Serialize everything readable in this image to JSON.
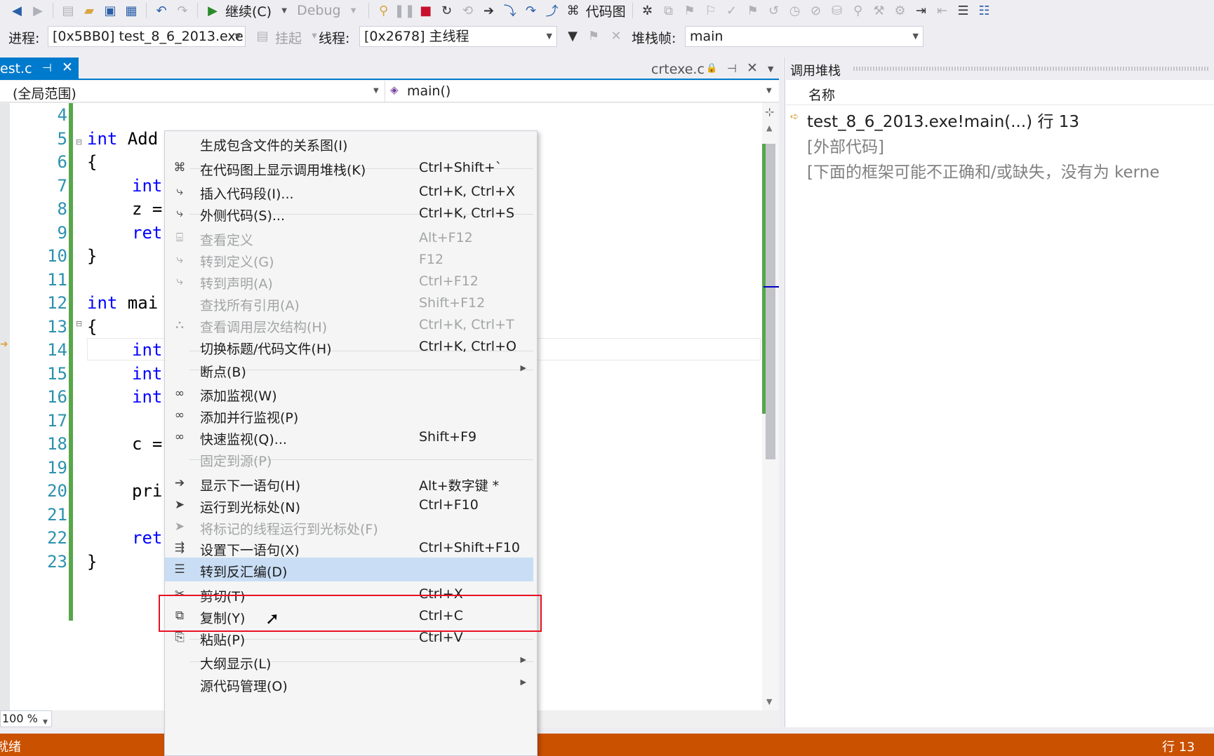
{
  "toolbar": {
    "continue_label": "继续(C)",
    "config_label": "Debug",
    "codemap_label": "代码图"
  },
  "debugbar": {
    "process_label": "进程:",
    "process_value": "[0x5BB0] test_8_6_2013.exe",
    "suspend_label": "挂起",
    "thread_label": "线程:",
    "thread_value": "[0x2678] 主线程",
    "stackframe_label": "堆栈帧:",
    "stackframe_value": "main"
  },
  "tabs": {
    "active": "est.c",
    "second": "crtexe.c"
  },
  "navbar": {
    "scope": "(全局范围)",
    "function": "main()"
  },
  "editor": {
    "lines": [
      {
        "num": "4",
        "kw": "",
        "rest": ""
      },
      {
        "num": "5",
        "kw": "int",
        "rest": " Add"
      },
      {
        "num": "6",
        "kw": "",
        "rest": "{"
      },
      {
        "num": "7",
        "kw": "int",
        "rest": ""
      },
      {
        "num": "8",
        "kw": "",
        "rest": "z ="
      },
      {
        "num": "9",
        "kw": "ret",
        "rest": ""
      },
      {
        "num": "10",
        "kw": "",
        "rest": "}"
      },
      {
        "num": "11",
        "kw": "",
        "rest": ""
      },
      {
        "num": "12",
        "kw": "int",
        "rest": " mai"
      },
      {
        "num": "13",
        "kw": "",
        "rest": "{"
      },
      {
        "num": "14",
        "kw": "int",
        "rest": ""
      },
      {
        "num": "15",
        "kw": "int",
        "rest": ""
      },
      {
        "num": "16",
        "kw": "int",
        "rest": ""
      },
      {
        "num": "17",
        "kw": "",
        "rest": ""
      },
      {
        "num": "18",
        "kw": "",
        "rest": "c ="
      },
      {
        "num": "19",
        "kw": "",
        "rest": ""
      },
      {
        "num": "20",
        "kw": "",
        "rest": "pri"
      },
      {
        "num": "21",
        "kw": "",
        "rest": ""
      },
      {
        "num": "22",
        "kw": "ret",
        "rest": ""
      },
      {
        "num": "23",
        "kw": "",
        "rest": "}"
      }
    ],
    "zoom": "100 %"
  },
  "callstack": {
    "title": "调用堆栈",
    "column_name": "名称",
    "rows": [
      "test_8_6_2013.exe!main(...) 行 13",
      "[外部代码]",
      "[下面的框架可能不正确和/或缺失，没有为 kerne"
    ]
  },
  "statusbar": {
    "left": "就绪",
    "right": "行 13"
  },
  "context_menu": {
    "items": [
      {
        "label": "生成包含文件的关系图(I)",
        "shortcut": "",
        "icon": "",
        "disabled": false
      },
      {
        "label": "在代码图上显示调用堆栈(K)",
        "shortcut": "Ctrl+Shift+`",
        "icon": "codemap-icon",
        "disabled": false
      },
      {
        "label": "插入代码段(I)...",
        "shortcut": "Ctrl+K, Ctrl+X",
        "icon": "snippet-icon",
        "disabled": false
      },
      {
        "label": "外侧代码(S)...",
        "shortcut": "Ctrl+K, Ctrl+S",
        "icon": "surround-icon",
        "disabled": false
      },
      {
        "label": "查看定义",
        "shortcut": "Alt+F12",
        "icon": "peek-icon",
        "disabled": true
      },
      {
        "label": "转到定义(G)",
        "shortcut": "F12",
        "icon": "goto-def-icon",
        "disabled": true
      },
      {
        "label": "转到声明(A)",
        "shortcut": "Ctrl+F12",
        "icon": "goto-decl-icon",
        "disabled": true
      },
      {
        "label": "查找所有引用(A)",
        "shortcut": "Shift+F12",
        "icon": "",
        "disabled": true
      },
      {
        "label": "查看调用层次结构(H)",
        "shortcut": "Ctrl+K, Ctrl+T",
        "icon": "hierarchy-icon",
        "disabled": true
      },
      {
        "label": "切换标题/代码文件(H)",
        "shortcut": "Ctrl+K, Ctrl+O",
        "icon": "",
        "disabled": false
      },
      {
        "label": "断点(B)",
        "shortcut": "",
        "icon": "",
        "disabled": false,
        "submenu": true
      },
      {
        "label": "添加监视(W)",
        "shortcut": "",
        "icon": "watch-icon",
        "disabled": false
      },
      {
        "label": "添加并行监视(P)",
        "shortcut": "",
        "icon": "watch-icon",
        "disabled": false
      },
      {
        "label": "快速监视(Q)...",
        "shortcut": "Shift+F9",
        "icon": "watch-icon",
        "disabled": false
      },
      {
        "label": "固定到源(P)",
        "shortcut": "",
        "icon": "",
        "disabled": true
      },
      {
        "label": "显示下一语句(H)",
        "shortcut": "Alt+数字键 *",
        "icon": "arrow-right-icon",
        "disabled": false
      },
      {
        "label": "运行到光标处(N)",
        "shortcut": "Ctrl+F10",
        "icon": "cursor-icon",
        "disabled": false
      },
      {
        "label": "将标记的线程运行到光标处(F)",
        "shortcut": "",
        "icon": "cursor-icon",
        "disabled": true
      },
      {
        "label": "设置下一语句(X)",
        "shortcut": "Ctrl+Shift+F10",
        "icon": "set-next-icon",
        "disabled": false
      },
      {
        "label": "转到反汇编(D)",
        "shortcut": "",
        "icon": "disassembly-icon",
        "disabled": false,
        "highlighted": true
      },
      {
        "label": "剪切(T)",
        "shortcut": "Ctrl+X",
        "icon": "scissors-icon",
        "disabled": false
      },
      {
        "label": "复制(Y)",
        "shortcut": "Ctrl+C",
        "icon": "copy-icon",
        "disabled": false
      },
      {
        "label": "粘贴(P)",
        "shortcut": "Ctrl+V",
        "icon": "paste-icon",
        "disabled": false
      },
      {
        "label": "大纲显示(L)",
        "shortcut": "",
        "icon": "",
        "disabled": false,
        "submenu": true
      },
      {
        "label": "源代码管理(O)",
        "shortcut": "",
        "icon": "",
        "disabled": false,
        "submenu": true
      }
    ]
  },
  "colors": {
    "accent": "#007acc",
    "status": "#ca5100",
    "highlight": "#c9def5",
    "annotation": "#e81123"
  }
}
